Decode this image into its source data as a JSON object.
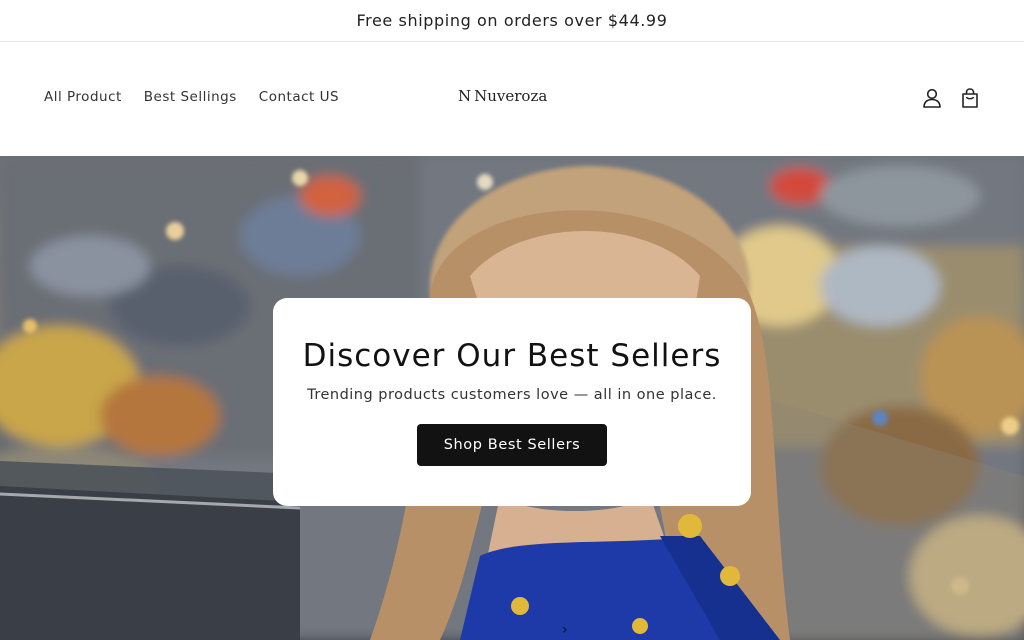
{
  "announcement": {
    "text": "Free shipping on orders over $44.99"
  },
  "nav": {
    "items": [
      "All Product",
      "Best Sellings",
      "Contact US"
    ]
  },
  "brand": {
    "logo_mark": "N",
    "name": "Nuveroza"
  },
  "header_icons": [
    "account-icon",
    "cart-icon"
  ],
  "hero": {
    "title": "Discover Our Best Sellers",
    "subtitle": "Trending products customers love — all in one place.",
    "button_label": "Shop Best Sellers",
    "chevron": "›"
  },
  "colors": {
    "button_bg": "#121212",
    "button_text": "#ffffff",
    "card_bg": "#ffffff"
  }
}
